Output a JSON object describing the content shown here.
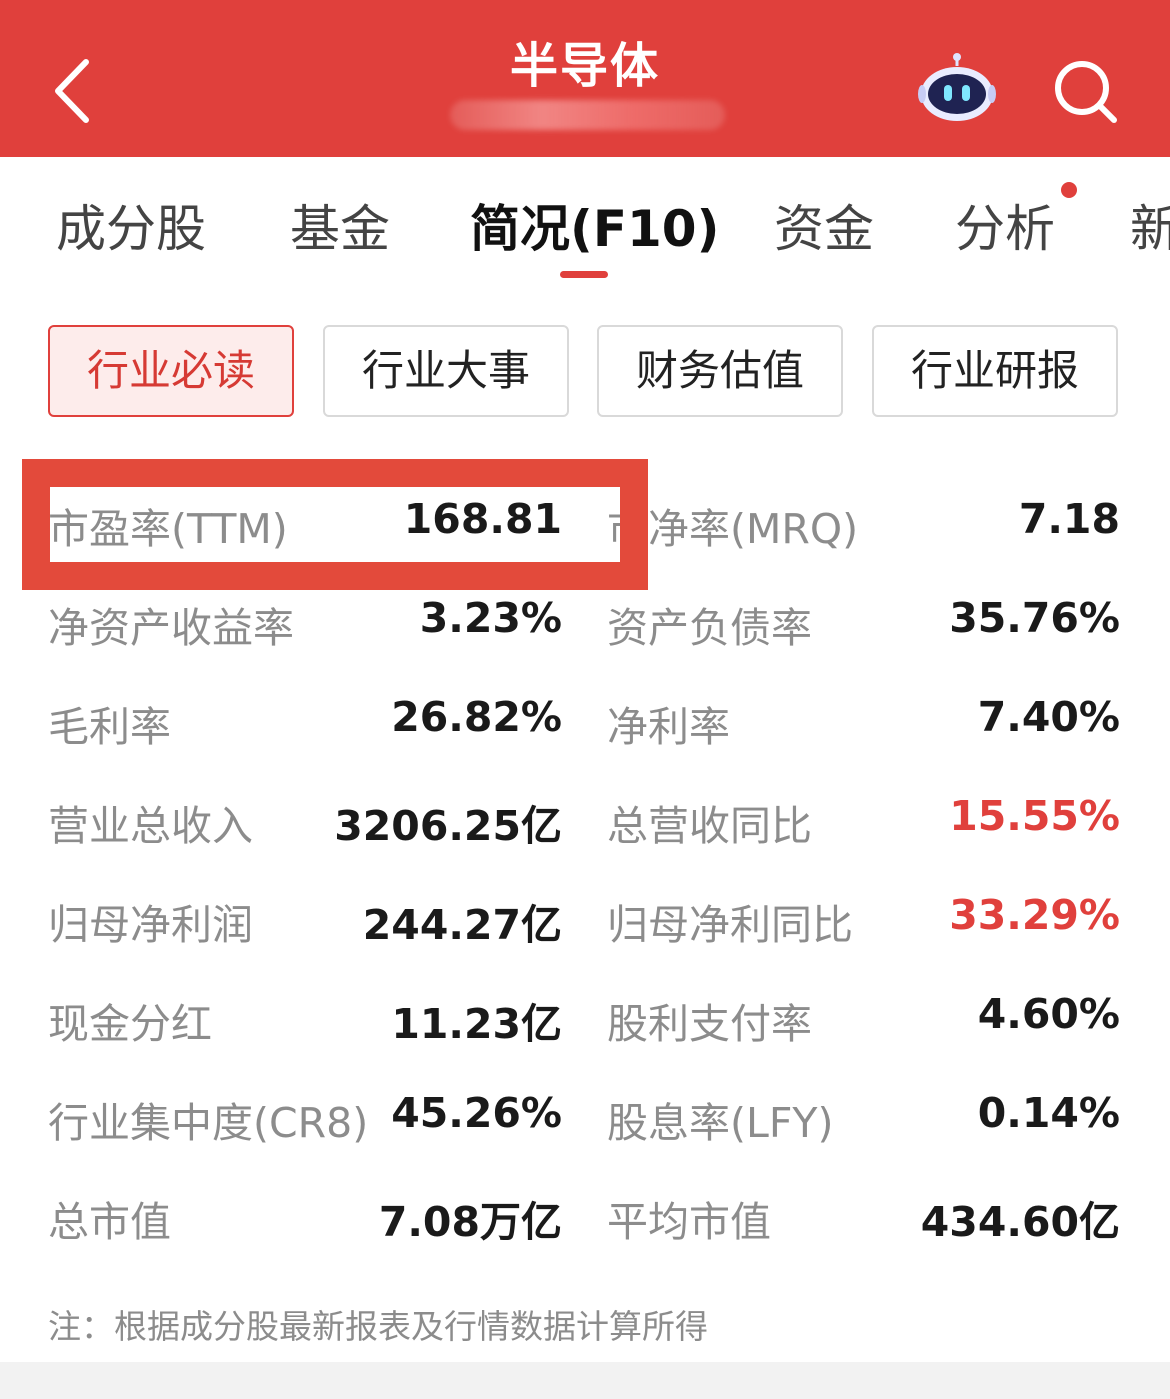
{
  "header": {
    "title": "半导体",
    "background": "#e0403c"
  },
  "tabs": [
    {
      "label": "成分股"
    },
    {
      "label": "基金"
    },
    {
      "label": "简况(F10)",
      "active": true
    },
    {
      "label": "资金"
    },
    {
      "label": "分析",
      "badge": true
    },
    {
      "label": "新"
    }
  ],
  "subtabs": [
    {
      "label": "行业必读",
      "active": true
    },
    {
      "label": "行业大事"
    },
    {
      "label": "财务估值"
    },
    {
      "label": "行业研报"
    }
  ],
  "metrics": [
    {
      "left_label": "市盈率(TTM)",
      "left_value": "168.81",
      "right_label": "市净率(MRQ)",
      "right_value": "7.18"
    },
    {
      "left_label": "净资产收益率",
      "left_value": "3.23%",
      "right_label": "资产负债率",
      "right_value": "35.76%"
    },
    {
      "left_label": "毛利率",
      "left_value": "26.82%",
      "right_label": "净利率",
      "right_value": "7.40%"
    },
    {
      "left_label": "营业总收入",
      "left_value": "3206.25亿",
      "right_label": "总营收同比",
      "right_value": "15.55%"
    },
    {
      "left_label": "归母净利润",
      "left_value": "244.27亿",
      "right_label": "归母净利同比",
      "right_value": "33.29%"
    },
    {
      "left_label": "现金分红",
      "left_value": "11.23亿",
      "right_label": "股利支付率",
      "right_value": "4.60%"
    },
    {
      "left_label": "行业集中度(CR8)",
      "left_value": "45.26%",
      "right_label": "股息率(LFY)",
      "right_value": "0.14%"
    },
    {
      "left_label": "总市值",
      "left_value": "7.08万亿",
      "right_label": "平均市值",
      "right_value": "434.60亿"
    }
  ],
  "colors": {
    "accent": "#e0403c",
    "highlight_box": "#e34a3b",
    "positive_value": "#e0403c"
  },
  "footnote": "注：根据成分股最新报表及行情数据计算所得",
  "icons": [
    "back-arrow-icon",
    "robot-assistant-icon",
    "search-icon"
  ]
}
